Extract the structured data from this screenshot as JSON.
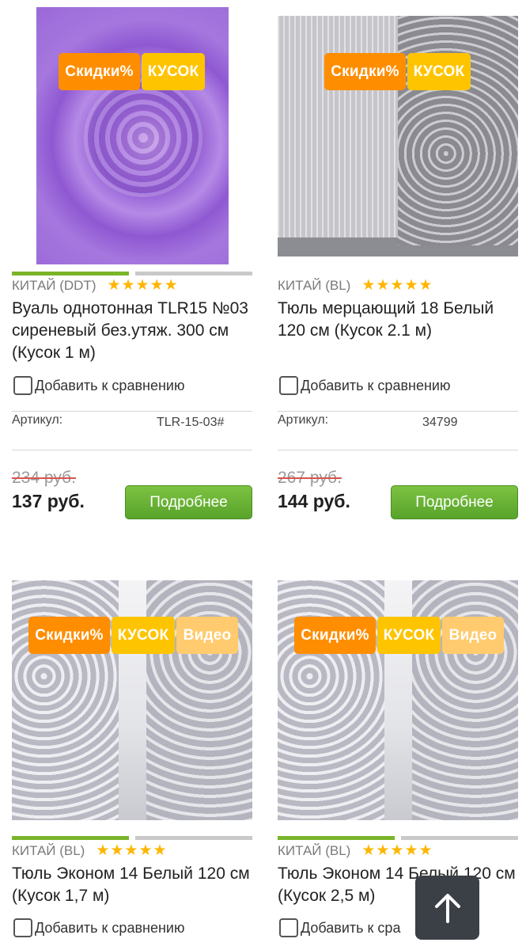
{
  "products": [
    {
      "badges": [
        "Скидки%",
        "КУСОК"
      ],
      "origin": "КИТАЙ (DDT)",
      "rating": "★★★★★",
      "title": "Вуаль однотонная TLR15 №03 сиреневый без.утяж. 300 см (Кусок 1 м)",
      "compare_label": "Добавить к сравнению",
      "sku_label": "Артикул:",
      "sku": "TLR-15-03#",
      "old_price": "234 руб.",
      "price": "137 руб.",
      "button": "Подробнее",
      "image_color": "#9662d6"
    },
    {
      "badges": [
        "Скидки%",
        "КУСОК"
      ],
      "origin": "КИТАЙ (BL)",
      "rating": "★★★★★",
      "title": "Тюль мерцающий 18 Белый 120 см (Кусок 2.1 м)",
      "compare_label": "Добавить к сравнению",
      "sku_label": "Артикул:",
      "sku": "34799",
      "old_price": "267 руб.",
      "price": "144 руб.",
      "button": "Подробнее"
    },
    {
      "badges": [
        "Скидки%",
        "КУСОК",
        "Видео"
      ],
      "origin": "КИТАЙ (BL)",
      "rating": "★★★★★",
      "title": "Тюль Эконом 14 Белый 120 см (Кусок 1,7 м)",
      "compare_label": "Добавить к сравнению"
    },
    {
      "badges": [
        "Скидки%",
        "КУСОК",
        "Видео"
      ],
      "origin": "КИТАЙ (BL)",
      "rating": "★★★★★",
      "title": "Тюль Эконом 14 Белый 120 см (Кусок 2,5 м)",
      "compare_label": "Добавить к сра"
    }
  ],
  "rating_fill": 1.0,
  "accent_colors": {
    "sale_badge": "#ff8d00",
    "piece_badge": "#ffc400",
    "video_badge": "#ffcb6e",
    "button": "#58a32b",
    "stars": "#ffb600"
  },
  "scroll_top_icon": "arrow-up-icon"
}
